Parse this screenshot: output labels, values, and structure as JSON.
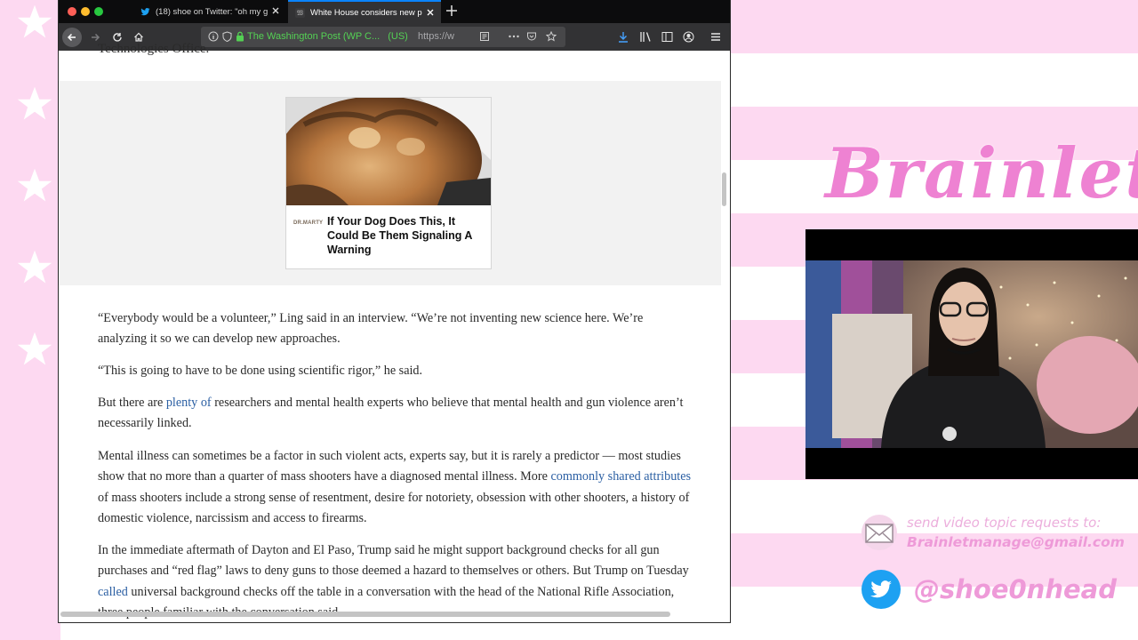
{
  "browser": {
    "tabs": [
      {
        "title": "(18) shoe on Twitter: \"oh my g",
        "icon": "twitter-icon",
        "active": false
      },
      {
        "title": "White House considers new pr",
        "icon": "washington-post-icon",
        "active": true
      }
    ],
    "url_identity": {
      "owner": "The Washington Post (WP C...",
      "country": "(US)"
    },
    "url_text": "https://w",
    "accent": "#0a84ff"
  },
  "page": {
    "cut_heading": "Technologies Office.",
    "ad": {
      "logo": "DR.MARTY",
      "headline": "If Your Dog Does This, It Could Be Them Signaling A Warning"
    },
    "paragraphs": {
      "p1": "“Everybody would be a volunteer,” Ling said in an interview. “We’re not inventing new science here. We’re analyzing it so we can develop new approaches.",
      "p2": "“This is going to have to be done using scientific rigor,” he said.",
      "p3_before": "But there are ",
      "p3_link": "plenty of",
      "p3_after": " researchers and mental health experts who believe that mental health and gun violence aren’t necessarily linked.",
      "p4_before": "Mental illness can sometimes be a factor in such violent acts, experts say, but it is rarely a predictor — most studies show that no more than a quarter of mass shooters have a diagnosed mental illness. More ",
      "p4_link": "commonly shared attributes",
      "p4_after": " of mass shooters include a strong sense of resentment, desire for notoriety, obsession with other shooters, a history of domestic violence, narcissism and access to firearms.",
      "p5_before": "In the immediate aftermath of Dayton and El Paso, Trump said he might support background checks for all gun purchases and “red flag” laws to deny guns to those deemed a hazard to themselves or others. But Trump on Tuesday ",
      "p5_link": "called",
      "p5_after": " universal background checks off the table in a conversation with the head of the National Rifle Association, three people familiar with the conversation said."
    }
  },
  "overlay": {
    "brand": "Brainlet",
    "brand_color": "#ee82d2",
    "request_label": "send video topic requests to:",
    "email": "Brainletmanage@gmail.com",
    "twitter_handle": "@shoe0nhead",
    "twitter_color": "#1da1f2"
  }
}
